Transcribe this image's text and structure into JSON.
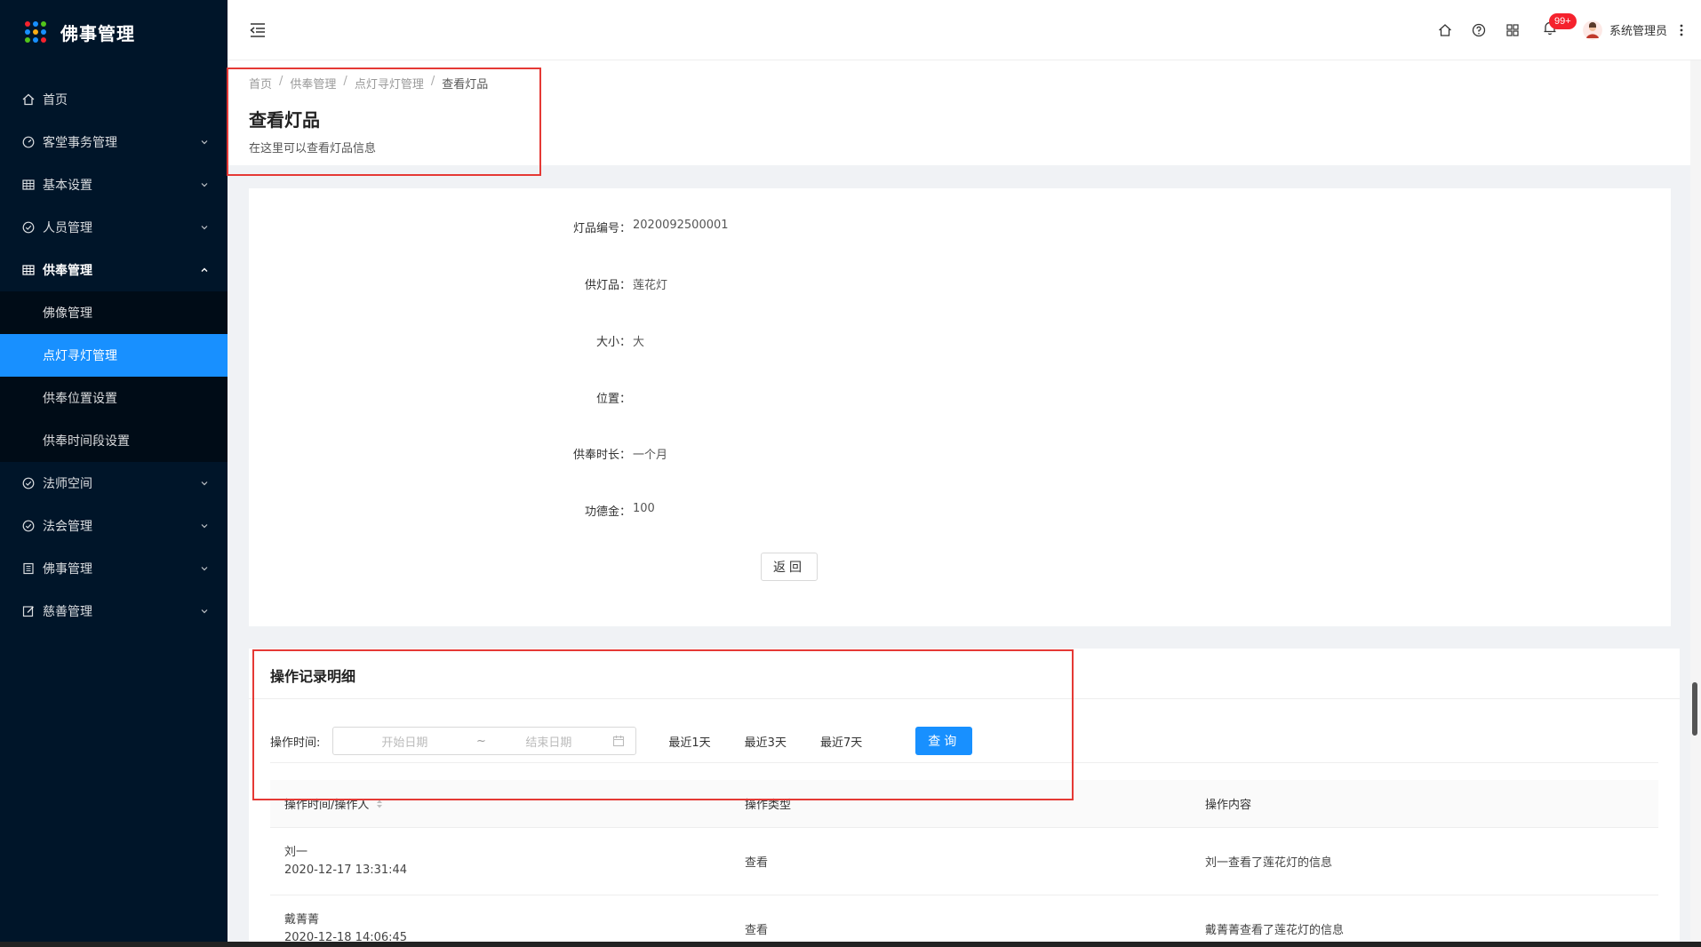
{
  "app": {
    "title": "佛事管理"
  },
  "sidebar": {
    "items": [
      {
        "label": "首页",
        "icon": "home-icon"
      },
      {
        "label": "客堂事务管理",
        "icon": "dashboard-icon"
      },
      {
        "label": "基本设置",
        "icon": "table-icon"
      },
      {
        "label": "人员管理",
        "icon": "check-circle-icon"
      },
      {
        "label": "供奉管理",
        "icon": "table-icon"
      },
      {
        "label": "法师空间",
        "icon": "check-circle-icon"
      },
      {
        "label": "法会管理",
        "icon": "check-circle-icon"
      },
      {
        "label": "佛事管理",
        "icon": "profile-icon"
      },
      {
        "label": "慈善管理",
        "icon": "edit-icon"
      }
    ],
    "submenu": [
      {
        "label": "佛像管理"
      },
      {
        "label": "点灯寻灯管理"
      },
      {
        "label": "供奉位置设置"
      },
      {
        "label": "供奉时间段设置"
      }
    ]
  },
  "header": {
    "notification_count": "99+",
    "user_name": "系统管理员"
  },
  "page": {
    "breadcrumb": [
      "首页",
      "供奉管理",
      "点灯寻灯管理",
      "查看灯品"
    ],
    "title": "查看灯品",
    "description": "在这里可以查看灯品信息"
  },
  "detail": {
    "fields": [
      {
        "label": "灯品编号：",
        "value": "2020092500001"
      },
      {
        "label": "供灯品：",
        "value": "莲花灯"
      },
      {
        "label": "大小：",
        "value": "大"
      },
      {
        "label": "位置：",
        "value": ""
      },
      {
        "label": "供奉时长：",
        "value": "一个月"
      },
      {
        "label": "功德金：",
        "value": "100"
      }
    ],
    "back_label": "返回"
  },
  "operations": {
    "title": "操作记录明细",
    "filter_label": "操作时间:",
    "start_placeholder": "开始日期",
    "end_placeholder": "结束日期",
    "tilde": "~",
    "quick": [
      "最近1天",
      "最近3天",
      "最近7天"
    ],
    "query_label": "查询",
    "columns": [
      "操作时间/操作人",
      "操作类型",
      "操作内容"
    ],
    "rows": [
      {
        "operator": "刘一",
        "time": "2020-12-17 13:31:44",
        "type": "查看",
        "content": "刘一查看了莲花灯的信息"
      },
      {
        "operator": "戴菁菁",
        "time": "2020-12-18 14:06:45",
        "type": "查看",
        "content": "戴菁菁查看了莲花灯的信息"
      }
    ]
  },
  "colors": {
    "sidebar_bg": "#001529",
    "accent": "#1890ff",
    "highlight_box": "#e53935",
    "badge": "#f5222d"
  }
}
